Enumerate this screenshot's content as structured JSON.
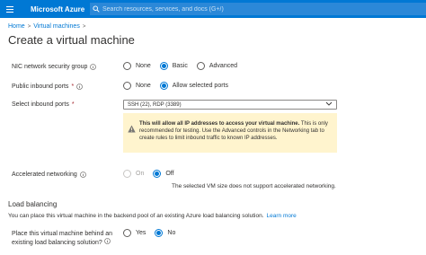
{
  "header": {
    "brand": "Microsoft Azure",
    "search_placeholder": "Search resources, services, and docs (G+/)"
  },
  "breadcrumb": {
    "home": "Home",
    "separator": ">",
    "virtual_machines": "Virtual machines"
  },
  "page": {
    "title": "Create a virtual machine"
  },
  "nsg": {
    "label": "NIC network security group",
    "options": [
      "None",
      "Basic",
      "Advanced"
    ],
    "selected": "Basic"
  },
  "inbound_ports": {
    "label": "Public inbound ports",
    "required_mark": "*",
    "options": [
      "None",
      "Allow selected ports"
    ],
    "selected": "Allow selected ports"
  },
  "select_ports": {
    "label": "Select inbound ports",
    "required_mark": "*",
    "value": "SSH (22), RDP (3389)"
  },
  "warning": {
    "bold": "This will allow all IP addresses to access your virtual machine.",
    "text": " This is only recommended for testing.  Use the Advanced controls in the Networking tab to create rules to limit inbound traffic to known IP addresses."
  },
  "accelerated": {
    "label": "Accelerated networking",
    "options": [
      "On",
      "Off"
    ],
    "selected": "Off",
    "note": "The selected VM size does not support accelerated networking."
  },
  "load_balancing": {
    "title": "Load balancing",
    "description": "You can place this virtual machine in the backend pool of an existing Azure load balancing solution.",
    "learn_more": "Learn more",
    "question": "Place this virtual machine behind an existing load balancing solution?",
    "options": [
      "Yes",
      "No"
    ],
    "selected": "No"
  },
  "colors": {
    "brand_blue": "#0078d4",
    "warning_bg": "#fff4ce",
    "required_red": "#a4262c"
  }
}
